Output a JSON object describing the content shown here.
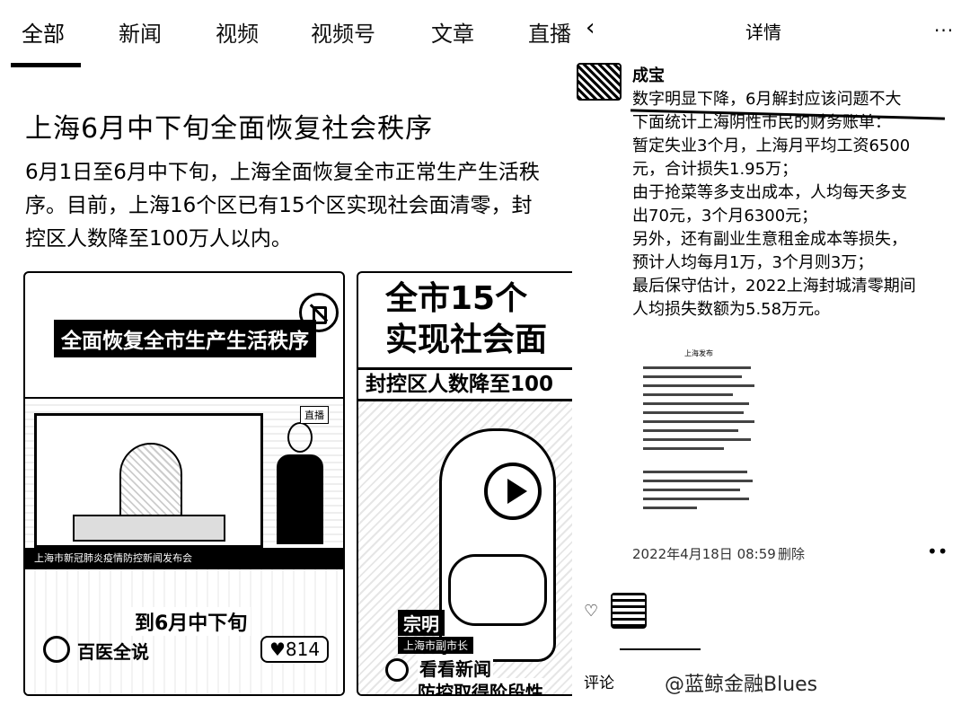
{
  "tabs": [
    {
      "label": "全部",
      "active": true
    },
    {
      "label": "新闻"
    },
    {
      "label": "视频"
    },
    {
      "label": "视频号"
    },
    {
      "label": "文章"
    },
    {
      "label": "直播"
    }
  ],
  "article": {
    "headline": "上海6月中下旬全面恢复社会秩序",
    "summary": "6月1日至6月中下旬，上海全面恢复全市正常生产生活秩序。目前，上海16个区已有15个区实现社会面清零，封控区人数降至100万人以内。"
  },
  "videos": [
    {
      "banner": "全面恢复全市生产生活秩序",
      "live_badge": "直播",
      "ticker": "上海市新冠肺炎疫情防控新闻发布会",
      "caption": "到6月中下旬",
      "source": "百医全说",
      "likes": "♥814"
    },
    {
      "title_line1": "全市15个",
      "title_line2": "实现社会面",
      "subtitle": "封控区人数降至100",
      "name": "宗明",
      "org": "上海市副市长",
      "news_label": "看看新闻",
      "bottom_text": "防控取得阶段性"
    }
  ],
  "detail": {
    "nav_title": "详情",
    "more_glyph": "···",
    "author": "成宝",
    "lines": [
      "数字明显下降，6月解封应该问题不大",
      "下面统计上海阴性市民的财务账单：",
      "暂定失业3个月，上海月平均工资6500",
      "元，合计损失1.95万；",
      "由于抢菜等多支出成本，人均每天多支",
      "出70元，3个月6300元；",
      "另外，还有副业生意租金成本等损失，",
      "预计人均每月1万，3个月则3万；",
      "最后保守估计，2022上海封城清零期间",
      "人均损失数额为5.58万元。"
    ],
    "doc_title": "上海发布",
    "timestamp": "2022年4月18日 08:59",
    "delete_label": "删除",
    "comment_label": "评论",
    "watermark": "@蓝鲸金融Blues"
  }
}
